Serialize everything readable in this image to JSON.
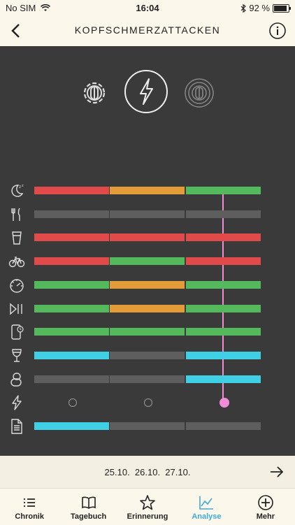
{
  "status": {
    "carrier": "No SIM",
    "time": "16:04",
    "battery": "92 %",
    "battery_level": 0.92
  },
  "nav": {
    "title": "KOPFSCHMERZATTACKEN"
  },
  "colors": {
    "red": "#e04a4a",
    "orange": "#e39c38",
    "green": "#54b95c",
    "gray": "#5e5e5e",
    "cyan": "#3fd0e6",
    "pink": "#f28cd6",
    "accent": "#41a9d9"
  },
  "rows": [
    {
      "name": "sleep-icon",
      "cells": [
        "red",
        "orange",
        "green"
      ]
    },
    {
      "name": "fork-knife-icon",
      "cells": [
        "gray",
        "gray",
        "gray"
      ]
    },
    {
      "name": "drink-glass-icon",
      "cells": [
        "red",
        "red",
        "red"
      ]
    },
    {
      "name": "bicycle-icon",
      "cells": [
        "red",
        "green",
        "red"
      ]
    },
    {
      "name": "stress-gauge-icon",
      "cells": [
        "green",
        "orange",
        "green"
      ]
    },
    {
      "name": "media-play-pause-icon",
      "cells": [
        "green",
        "orange",
        "green"
      ]
    },
    {
      "name": "screen-time-icon",
      "cells": [
        "green",
        "green",
        "green"
      ]
    },
    {
      "name": "wine-glass-icon",
      "cells": [
        "cyan",
        "gray",
        "cyan"
      ]
    },
    {
      "name": "medication-icon",
      "cells": [
        "gray",
        "gray",
        "cyan"
      ]
    },
    {
      "name": "lightning-row-icon",
      "cells": [
        "circle",
        "circle",
        "circle-active"
      ]
    },
    {
      "name": "notes-document-icon",
      "cells": [
        "cyan",
        "gray",
        "gray"
      ]
    }
  ],
  "dates": "25.10.  26.10.  27.10.",
  "tabs": [
    {
      "label": "Chronik",
      "icon": "list-icon"
    },
    {
      "label": "Tagebuch",
      "icon": "book-icon"
    },
    {
      "label": "Erinnerung",
      "icon": "star-icon"
    },
    {
      "label": "Analyse",
      "icon": "chart-icon",
      "active": true
    },
    {
      "label": "Mehr",
      "icon": "plus-circle-icon"
    }
  ]
}
